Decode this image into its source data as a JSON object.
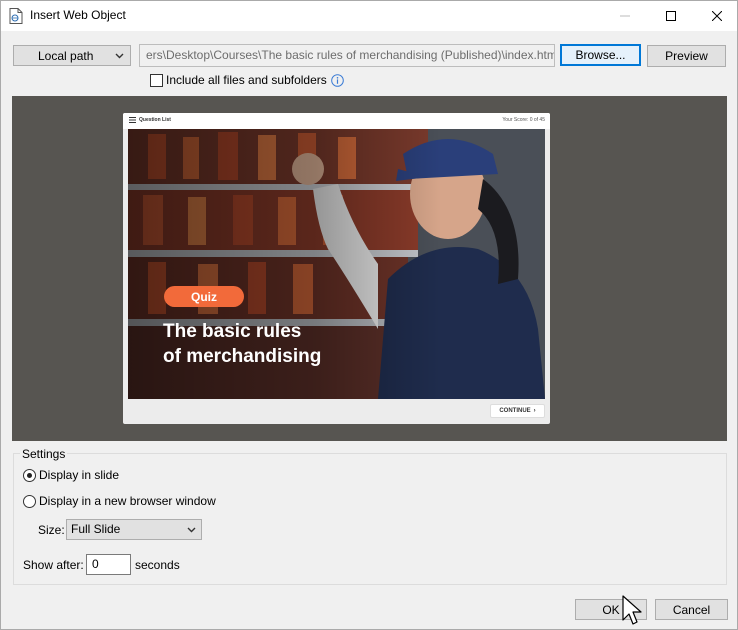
{
  "window": {
    "title": "Insert Web Object",
    "icon": "web-object-doc-icon"
  },
  "source": {
    "type_selected": "Local path",
    "path_value": "ers\\Desktop\\Courses\\The basic rules of merchandising (Published)\\index.html",
    "browse_label": "Browse...",
    "preview_label": "Preview",
    "include_label": "Include all files and subfolders",
    "include_checked": false
  },
  "preview": {
    "header_left": "Question List",
    "header_right": "Your Score: 0 of 45",
    "badge": "Quiz",
    "title_line1": "The basic rules",
    "title_line2": "of merchandising",
    "continue_label": "CONTINUE"
  },
  "settings": {
    "legend": "Settings",
    "option_slide": "Display in slide",
    "option_window": "Display in a new browser window",
    "selected": "Display in slide",
    "size_label": "Size:",
    "size_value": "Full Slide",
    "show_after_label": "Show after:",
    "show_after_value": "0",
    "seconds_label": "seconds"
  },
  "footer": {
    "ok_label": "OK",
    "cancel_label": "Cancel"
  },
  "colors": {
    "accent": "#0078d7",
    "preview_bg": "#575551",
    "quiz_badge": "#f26a3a"
  }
}
